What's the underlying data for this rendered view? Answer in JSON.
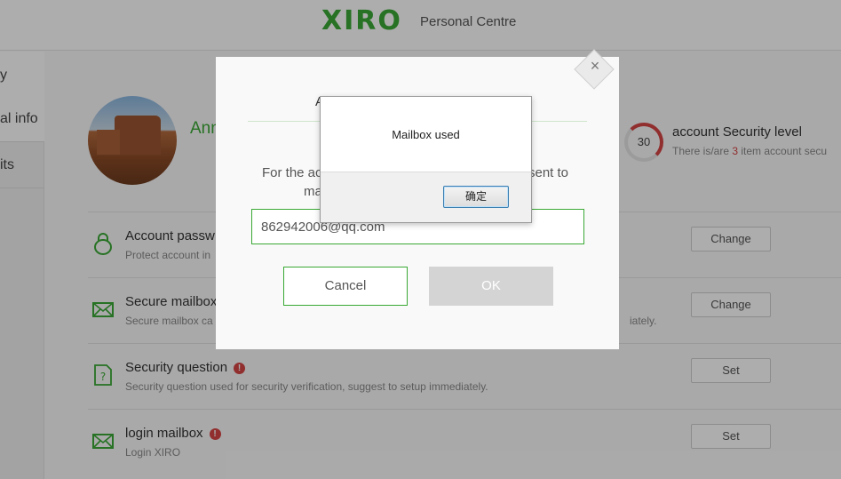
{
  "header": {
    "logo": "XIRO",
    "subtitle": "Personal Centre"
  },
  "leftnav": {
    "top_label": "y",
    "items": [
      {
        "label": "al info"
      },
      {
        "label": "its"
      }
    ]
  },
  "profile": {
    "name": "Ann"
  },
  "security": {
    "score": "30",
    "title": "account Security level",
    "sub_prefix": "There is/are ",
    "sub_count": "3",
    "sub_suffix": " item account secu"
  },
  "rows": [
    {
      "title": "Account passw",
      "desc": "Protect account in",
      "tail": "",
      "button": "Change"
    },
    {
      "title": "Secure mailbox",
      "desc": "Secure mailbox ca",
      "tail": "iately.",
      "button": "Change"
    },
    {
      "title": "Security question",
      "desc": "Security question used for security verification, suggest to setup immediately.",
      "tail": "",
      "button": "Set"
    },
    {
      "title": "login mailbox",
      "desc": "Login XIRO",
      "tail": "",
      "button": "Set"
    }
  ],
  "modal": {
    "title": "A",
    "text1": "For the ac",
    "text1b": "sent to",
    "text2": "ma",
    "input_value": "862942006@qq.com",
    "cancel_label": "Cancel",
    "ok_label": "OK",
    "close_glyph": "×"
  },
  "alert": {
    "message": "Mailbox used",
    "button": "确定"
  },
  "colors": {
    "brand": "#3aa935",
    "warn": "#d64545"
  }
}
